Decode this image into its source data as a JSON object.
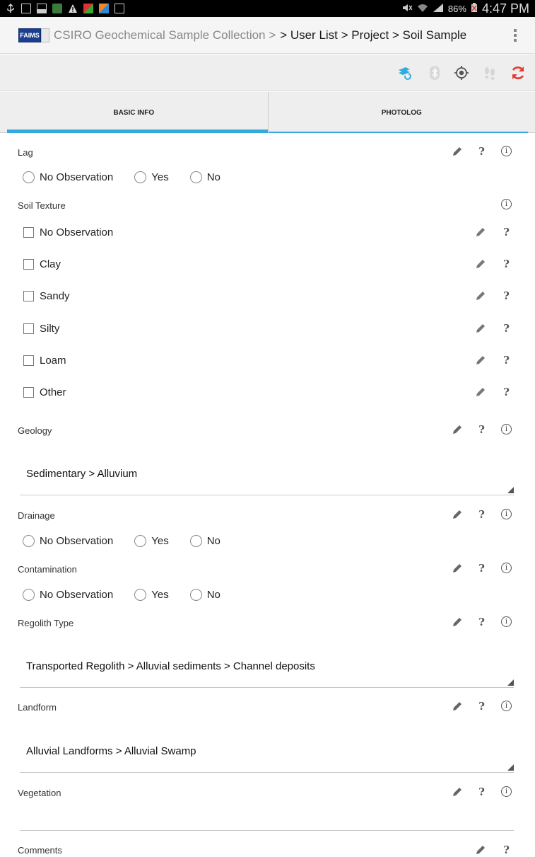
{
  "status_bar": {
    "battery": "86%",
    "time": "4:47 PM"
  },
  "action_bar": {
    "logo_text": "FAIMS",
    "app_title": "CSIRO Geochemical Sample Collection >",
    "breadcrumb": "> User List > Project > Soil Sample"
  },
  "toolbar": {
    "icons": [
      "sync-status-icon",
      "bluetooth-icon",
      "gps-icon",
      "tracking-icon",
      "refresh-icon"
    ],
    "colors": {
      "sync": "#33aadd",
      "disabled": "#cfcfcf",
      "gps": "#555555",
      "refresh": "#e53935"
    }
  },
  "tabs": [
    {
      "label": "BASIC INFO",
      "active": true
    },
    {
      "label": "PHOTOLOG",
      "active": false
    }
  ],
  "form": {
    "lag": {
      "label": "Lag",
      "options": [
        "No Observation",
        "Yes",
        "No"
      ]
    },
    "soil_texture": {
      "label": "Soil Texture",
      "options": [
        "No Observation",
        "Clay",
        "Sandy",
        "Silty",
        "Loam",
        "Other"
      ]
    },
    "geology": {
      "label": "Geology",
      "value": "Sedimentary > Alluvium"
    },
    "drainage": {
      "label": "Drainage",
      "options": [
        "No Observation",
        "Yes",
        "No"
      ]
    },
    "contamination": {
      "label": "Contamination",
      "options": [
        "No Observation",
        "Yes",
        "No"
      ]
    },
    "regolith_type": {
      "label": "Regolith Type",
      "value": "Transported Regolith > Alluvial sediments > Channel deposits"
    },
    "landform": {
      "label": "Landform",
      "value": "Alluvial Landforms > Alluvial Swamp"
    },
    "vegetation": {
      "label": "Vegetation",
      "value": ""
    },
    "comments": {
      "label": "Comments"
    }
  },
  "glyphs": {
    "help": "?",
    "info": "i"
  }
}
